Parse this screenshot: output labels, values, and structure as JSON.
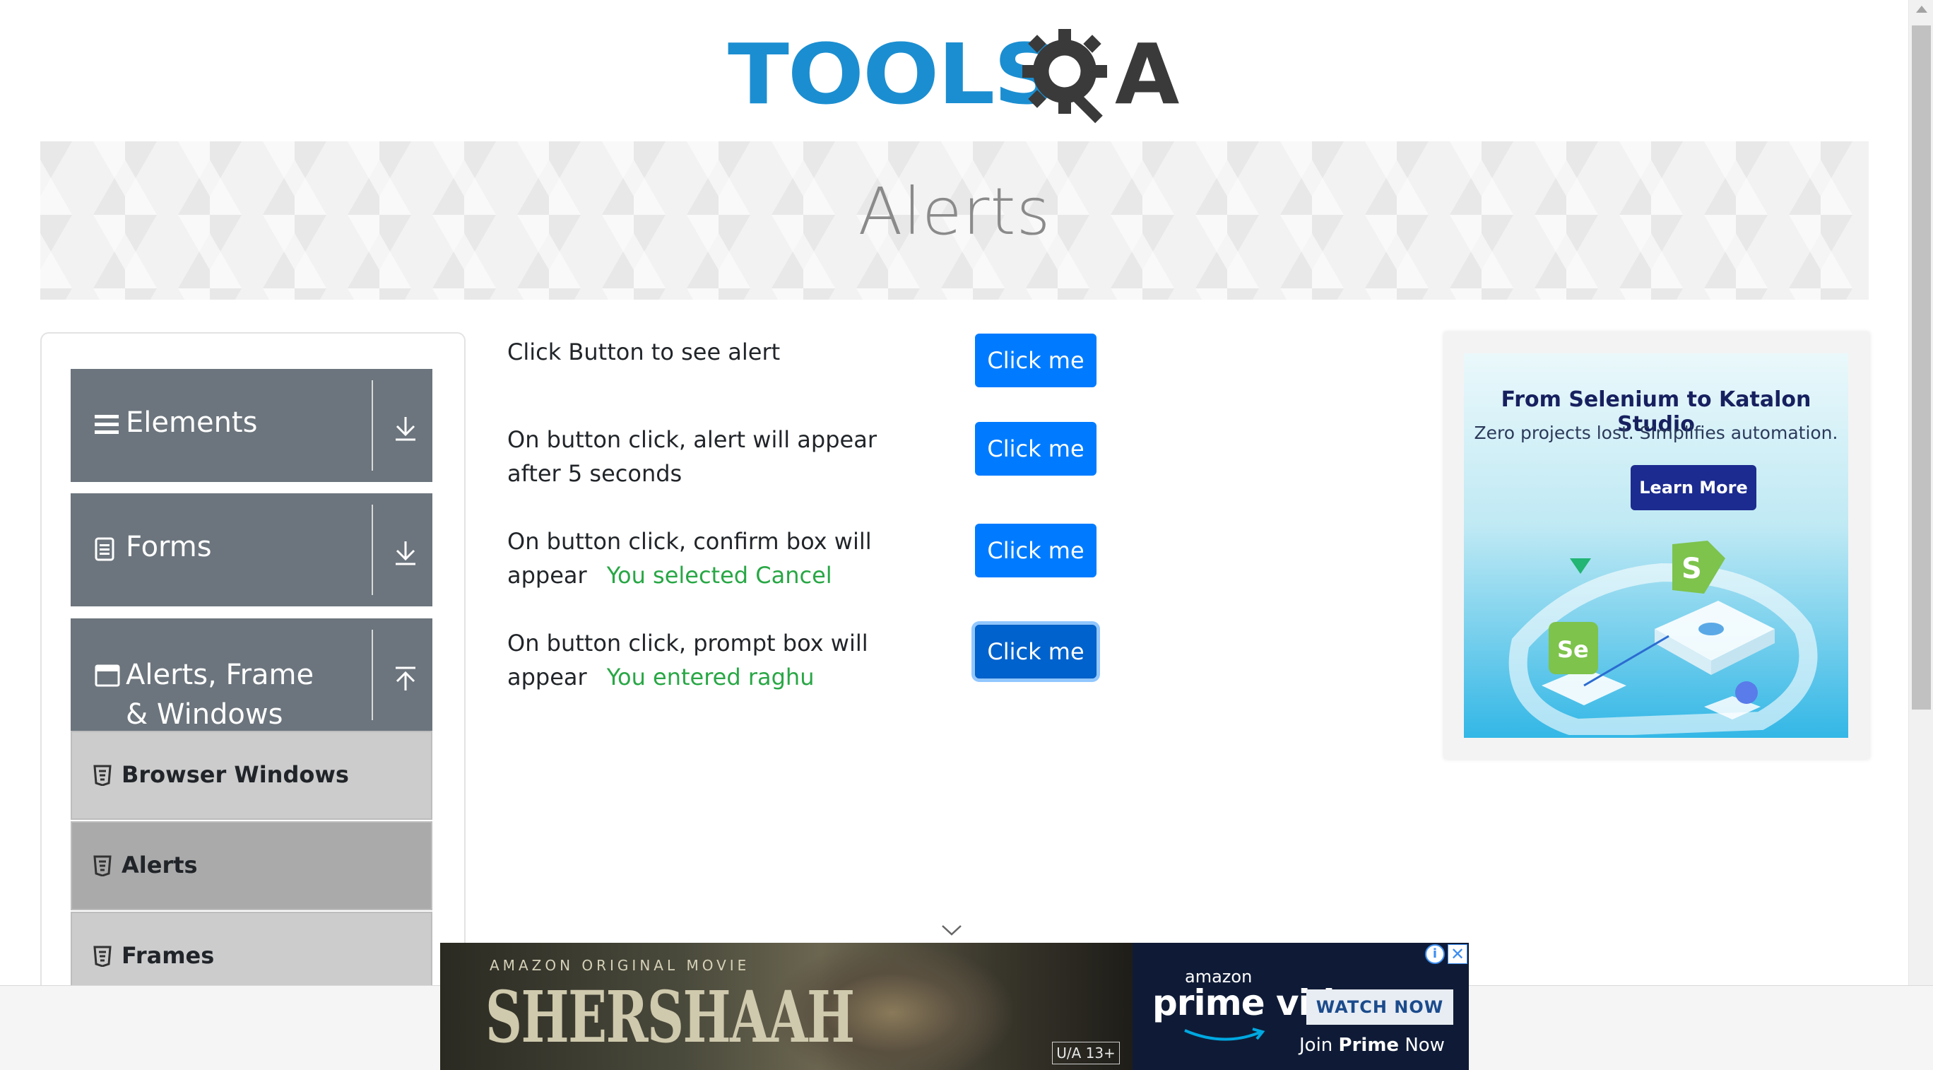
{
  "header": {
    "logo_text": "TOOLS",
    "logo_suffix": "A"
  },
  "banner": {
    "title": "Alerts"
  },
  "sidebar": {
    "groups": [
      {
        "label": "Elements",
        "icon": "hamburger-icon",
        "state": "collapsed"
      },
      {
        "label": "Forms",
        "icon": "document-icon",
        "state": "collapsed"
      },
      {
        "label": "Alerts, Frame & Windows",
        "icon": "window-icon",
        "state": "expanded"
      }
    ],
    "items": [
      {
        "label": "Browser Windows",
        "icon": "html5-icon",
        "active": false
      },
      {
        "label": "Alerts",
        "icon": "html5-icon",
        "active": true
      },
      {
        "label": "Frames",
        "icon": "html5-icon",
        "active": false
      }
    ]
  },
  "main": {
    "rows": [
      {
        "text": "Click Button to see alert",
        "result": "",
        "button": "Click me"
      },
      {
        "text": "On button click, alert will appear after 5 seconds",
        "result": "",
        "button": "Click me"
      },
      {
        "text": "On button click, confirm box will appear",
        "result": "You selected Cancel",
        "button": "Click me"
      },
      {
        "text": "On button click, prompt box will appear",
        "result": "You entered raghu",
        "button": "Click me"
      }
    ]
  },
  "ad_right": {
    "title": "From Selenium to Katalon Studio",
    "subtitle": "Zero projects lost. Simplifies automation.",
    "button": "Learn More",
    "art_badge_1": "S",
    "art_badge_2": "Se"
  },
  "ad_bottom": {
    "movie_sup": "AMAZON ORIGINAL MOVIE",
    "movie_title": "SHERSHAAH",
    "rating": "U/A 13+",
    "brand_top": "amazon",
    "brand": "prime video",
    "cta": "WATCH NOW",
    "join_prefix": "Join",
    "join_bold": "Prime",
    "join_suffix": "Now",
    "info_icon": "i",
    "close_icon": "✕"
  },
  "colors": {
    "primary": "#007bff",
    "success": "#28a745",
    "sidebar_group": "#6c757d",
    "logo_blue": "#1b8ed1"
  }
}
